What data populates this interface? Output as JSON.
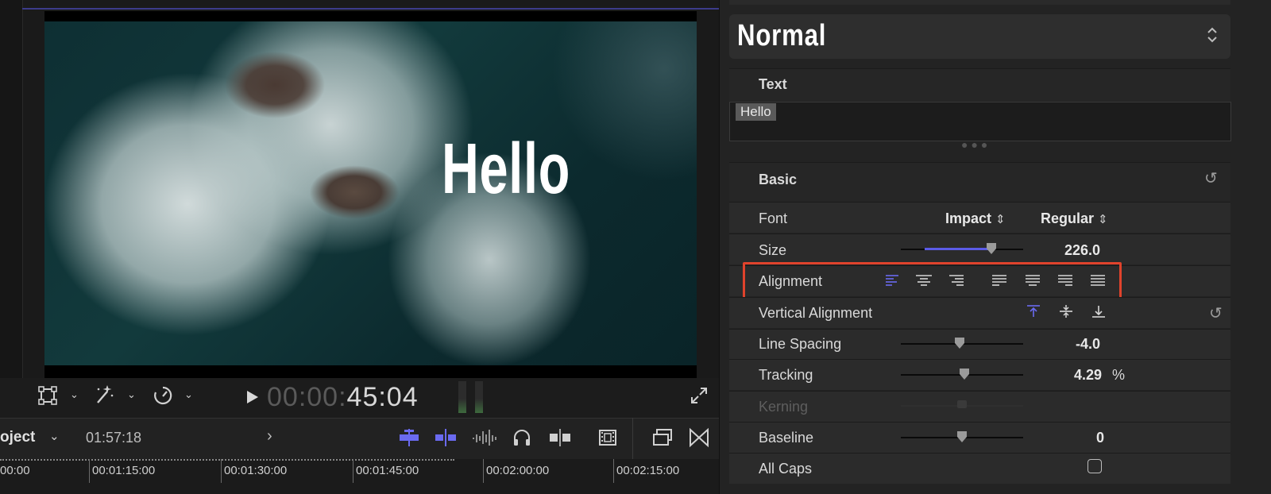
{
  "viewer": {
    "overlay_text": "Hello",
    "timecode_dim": "00:00:",
    "timecode_bright": "45:04"
  },
  "timeline": {
    "project_label": "oject",
    "duration": "01:57:18",
    "ruler": [
      "00:00",
      "00:01:15:00",
      "00:01:30:00",
      "00:01:45:00",
      "00:02:00:00",
      "00:02:15:00"
    ]
  },
  "inspector": {
    "preset": "Normal",
    "text_section_label": "Text",
    "text_value": "Hello",
    "basic_label": "Basic",
    "font_label": "Font",
    "font_family": "Impact",
    "font_style": "Regular",
    "size_label": "Size",
    "size_value": "226.0",
    "size_fraction": 0.74,
    "alignment_label": "Alignment",
    "valign_label": "Vertical Alignment",
    "line_spacing_label": "Line Spacing",
    "line_spacing_value": "-4.0",
    "line_spacing_fraction": 0.48,
    "tracking_label": "Tracking",
    "tracking_value": "4.29",
    "tracking_unit": "%",
    "tracking_fraction": 0.52,
    "kerning_label": "Kerning",
    "baseline_label": "Baseline",
    "baseline_value": "0",
    "baseline_fraction": 0.5,
    "allcaps_label": "All Caps"
  },
  "colors": {
    "accent": "#5b5be6",
    "highlight_box": "#e0432c"
  }
}
